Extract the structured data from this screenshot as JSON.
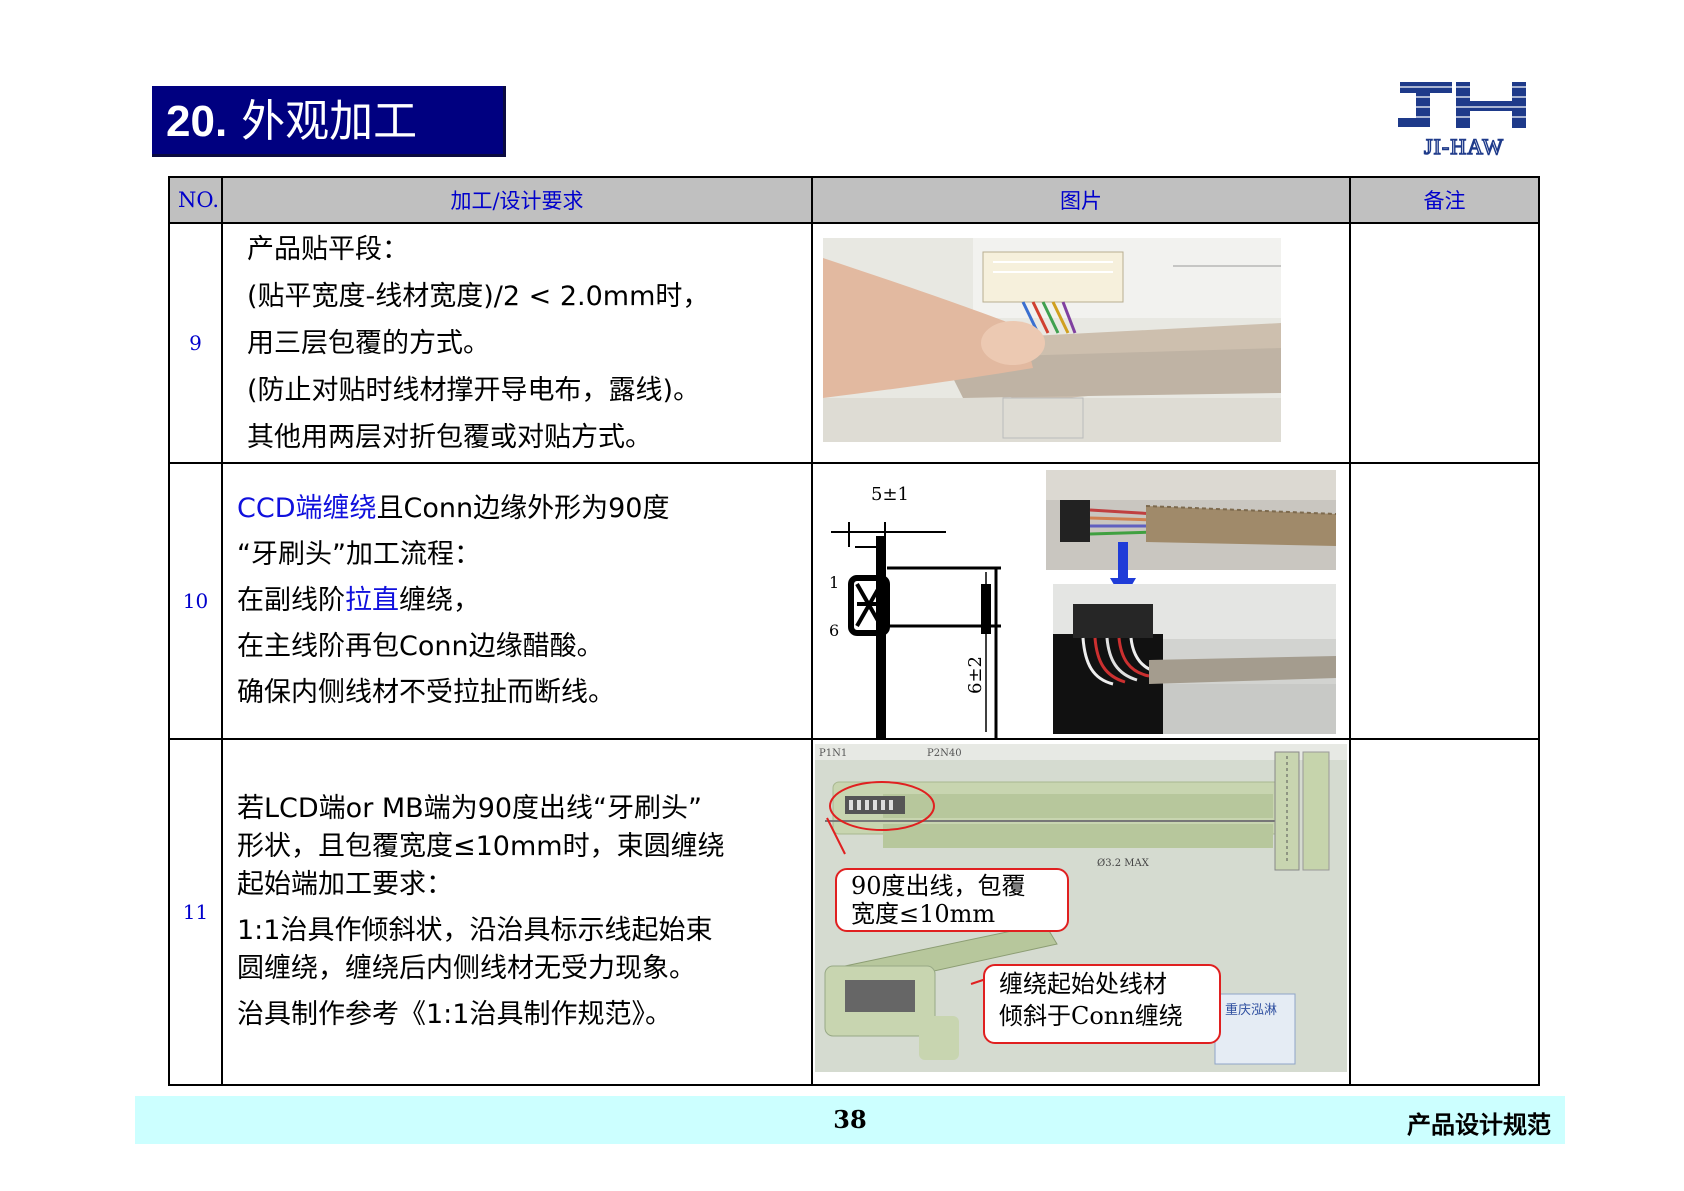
{
  "header": {
    "number": "20.",
    "title": "外观加工"
  },
  "logo": {
    "text": "JI-HAW",
    "color": "#1e3a8a"
  },
  "table": {
    "columns": [
      "NO.",
      "加工/设计要求",
      "图片",
      "备注"
    ],
    "rows": [
      {
        "no": "9",
        "lines": [
          "产品贴平段：",
          "(贴平宽度-线材宽度)/2 < 2.0mm时，",
          "用三层包覆的方式。",
          "(防止对贴时线材撑开导电布，露线)。",
          "其他用两层对折包覆或对贴方式。"
        ]
      },
      {
        "no": "10",
        "line1_blue": "CCD端缠绕",
        "line1_rest": "且Conn边缘外形为90度",
        "line2": "“牙刷头”加工流程：",
        "line3_a": "在副线阶",
        "line3_blue": "拉直",
        "line3_b": "缠绕，",
        "line4": "在主线阶再包Conn边缘醋酸。",
        "line5": "确保内侧线材不受拉扯而断线。",
        "drawing": {
          "dim_top": "5±1",
          "dim_side": "6±2",
          "label_1": "1",
          "label_6": "6"
        }
      },
      {
        "no": "11",
        "lines": [
          "若LCD端or MB端为90度出线“牙刷头”",
          "形状，且包覆宽度≤10mm时，束圆缠绕",
          "起始端加工要求：",
          "1:1治具作倾斜状，沿治具标示线起始束",
          "圆缠绕，缠绕后内侧线材无受力现象。",
          "治具制作参考《1:1治具制作规范》。"
        ],
        "callout1": [
          "90度出线，包覆",
          "宽度≤10mm"
        ],
        "callout2": [
          "缠绕起始处线材",
          "倾斜于Conn缠绕"
        ],
        "photo_labels": {
          "p1n1": "P1N1",
          "p2n40": "P2N40",
          "dim": "Ø3.2 MAX",
          "stamp": "重庆泓淋"
        }
      }
    ]
  },
  "footer": {
    "page": "38",
    "spec": "产品设计规范"
  }
}
